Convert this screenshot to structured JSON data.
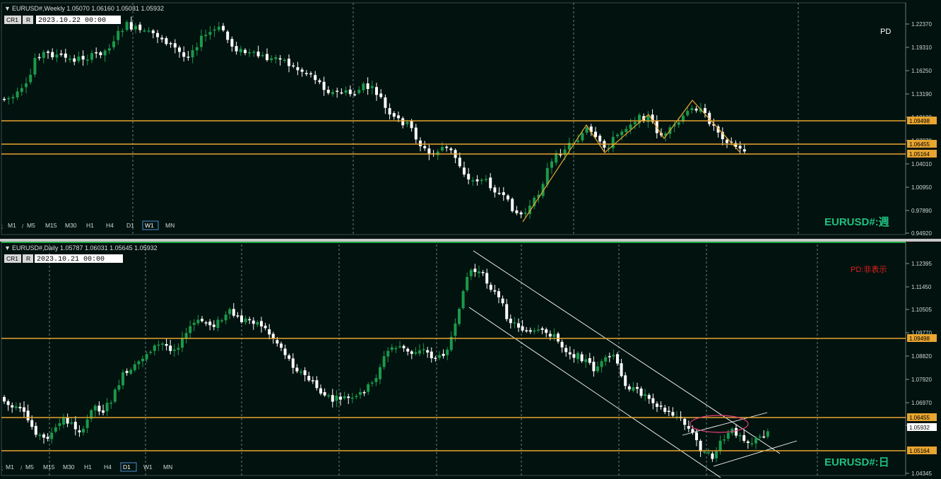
{
  "weekly": {
    "header": "EURUSD#,Weekly  1.05070 1.06160 1.05031 1.05932",
    "cr_label": "CR1",
    "r_label": "R",
    "date_value": "2023.10.22 00:00",
    "pd_label": "PD",
    "watermark": "EURUSD#:週",
    "price_ticks": [
      "1.22370",
      "1.19310",
      "1.16250",
      "1.13190",
      "1.10130",
      "1.07070",
      "1.04010",
      "1.00950",
      "0.97890",
      "0.94920"
    ],
    "level_labels": [
      "1.09498",
      "1.06455",
      "1.05164"
    ],
    "timeframes": [
      "M1",
      "M5",
      "M15",
      "M30",
      "H1",
      "H4",
      "D1",
      "W1",
      "MN"
    ],
    "active_timeframe": "W1"
  },
  "daily": {
    "header": "EURUSD#,Daily  1.05787 1.06031 1.05645 1.05932",
    "cr_label": "CR1",
    "r_label": "R",
    "date_value": "2023.10.21 00:00",
    "pd_label": "PD:非表示",
    "watermark": "EURUSD#:日",
    "price_ticks": [
      "1.12395",
      "1.11450",
      "1.10505",
      "1.09770",
      "1.08820",
      "1.07920",
      "1.06970",
      "1.06120",
      "1.04345"
    ],
    "level_labels": [
      "1.09498",
      "1.06455",
      "1.05932",
      "1.05164"
    ],
    "timeframes": [
      "M1",
      "M5",
      "M15",
      "M30",
      "H1",
      "H4",
      "D1",
      "W1",
      "MN"
    ],
    "active_timeframe": "D1"
  },
  "colors": {
    "background": "#02120f",
    "bull": "#1a9a4a",
    "bear": "#ffffff",
    "level": "#e8a530",
    "accent_text": "#20c080",
    "ellipse": "#e0407a"
  }
}
